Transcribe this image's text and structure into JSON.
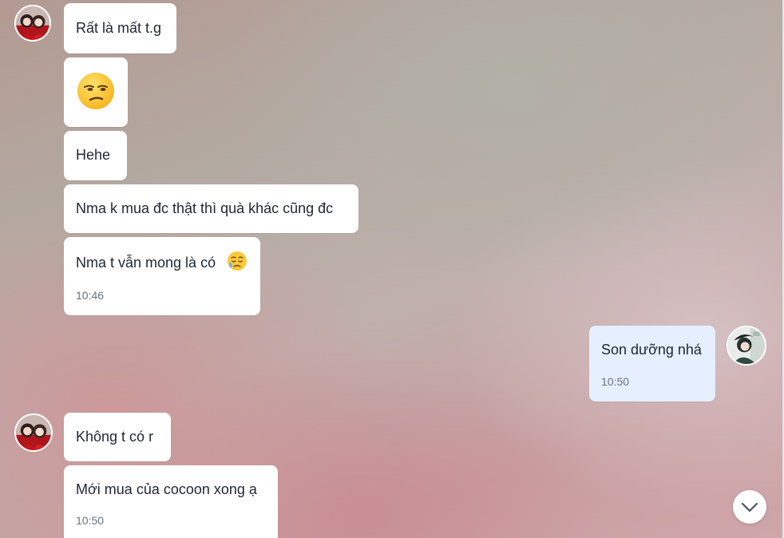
{
  "messages": {
    "m1": {
      "text": "Rất là mất t.g"
    },
    "m2": {
      "emoji": "unamused-face-emoji"
    },
    "m3": {
      "text": "Hehe"
    },
    "m4": {
      "text": "Nma k mua đc thật thì quà khác cũng đc"
    },
    "m5": {
      "text": "Nma t vẫn mong là có",
      "emoji": "sad-relieved-face-emoji",
      "time": "10:46"
    },
    "m6": {
      "text": "Son dưỡng nhá",
      "time": "10:50"
    },
    "m7": {
      "text": "Không t có r"
    },
    "m8": {
      "text": "Mới mua của cocoon xong ạ",
      "time": "10:50"
    }
  },
  "icons": {
    "scroll_down": "chevron-down-icon",
    "sender_avatar": "avatar",
    "my_avatar": "avatar"
  },
  "colors": {
    "incoming_bubble": "#ffffff",
    "outgoing_bubble": "#e5efff",
    "text": "#1f2733",
    "time": "#6b7280"
  }
}
